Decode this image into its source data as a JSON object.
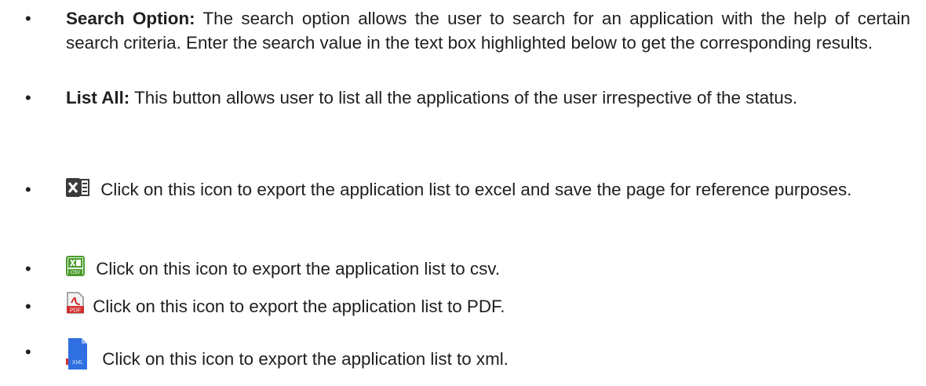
{
  "items": [
    {
      "term": "Search Option:",
      "text": "The search option allows the user to search for an application with the help of certain search criteria. Enter the search value in the text box highlighted below to get the corresponding results."
    },
    {
      "term": "List All:",
      "text": "This button allows user to list all the applications of the user irrespective of the status."
    },
    {
      "icon": "excel-icon",
      "text": "Click on this icon to export the application list to excel and save the page for reference purposes."
    },
    {
      "icon": "csv-icon",
      "text": "Click on this icon to export the application list to csv."
    },
    {
      "icon": "pdf-icon",
      "text": "Click on this icon to export the application list to PDF."
    },
    {
      "icon": "xml-icon",
      "text": "Click on this icon to export the application list to xml."
    }
  ],
  "icon_labels": {
    "csv": "CSV",
    "pdf": "PDF",
    "xml": "XML"
  },
  "colors": {
    "excel": "#217346",
    "csv": "#4a9c2d",
    "pdf": "#d32f2f",
    "xml": "#2f6fe0",
    "text": "#1f1f1f"
  }
}
